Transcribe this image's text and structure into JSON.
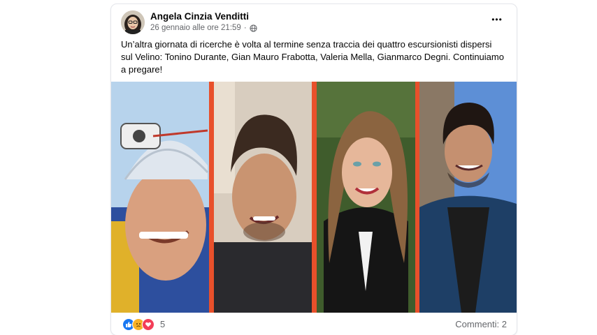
{
  "post": {
    "author_name": "Angela Cinzia Venditti",
    "timestamp": "26 gennaio alle ore 21:59",
    "separator": "·",
    "privacy_icon": "globe-icon",
    "more_label": "•••",
    "text": "Un’altra giornata di ricerche è volta al termine senza traccia dei quattro escursionisti dispersi sul Velino: Tonino Durante, Gian Mauro Frabotta, Valeria Mella, Gianmarco Degni. Continuiamo a pregare!"
  },
  "reactions": {
    "icons": [
      "like-icon",
      "sad-icon",
      "love-icon"
    ],
    "count": "5",
    "comments_label": "Commenti: 2"
  },
  "colors": {
    "like": "#1877f2",
    "sad": "#f7b125",
    "love": "#f33e58",
    "photo_border": "#e8502b",
    "secondary_text": "#65676b"
  }
}
